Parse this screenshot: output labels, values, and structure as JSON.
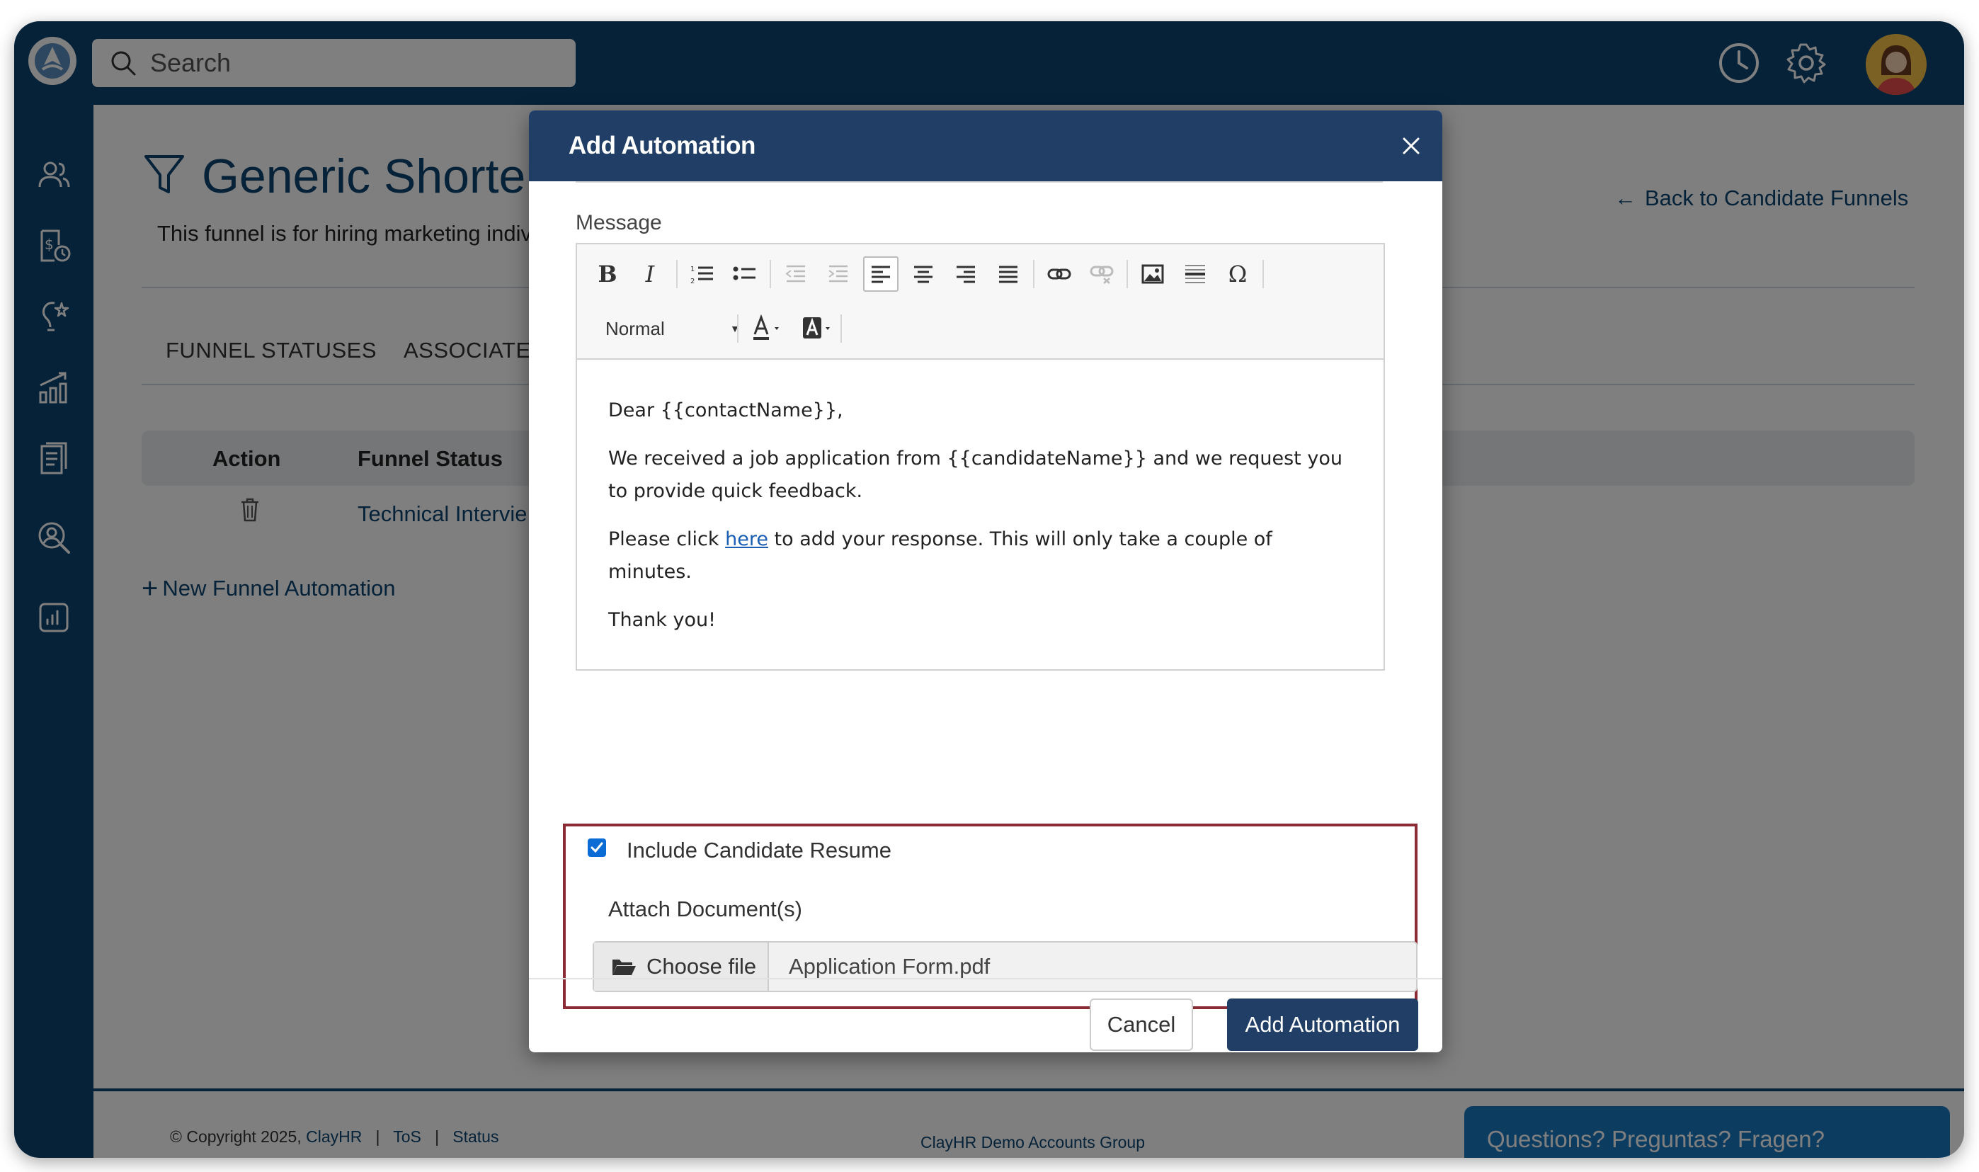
{
  "search": {
    "placeholder": "Search"
  },
  "page": {
    "title": "Generic Shorter",
    "subtitle": "This funnel is for hiring marketing indivi",
    "back_link": "Back to Candidate Funnels",
    "tabs": [
      "FUNNEL STATUSES",
      "ASSOCIATED"
    ],
    "table": {
      "headers": [
        "Action",
        "Funnel Status"
      ],
      "rows": [
        {
          "status": "Technical Intervie"
        }
      ]
    },
    "new_automation": "New Funnel Automation"
  },
  "footer": {
    "copyright": "© Copyright 2025,",
    "brand": "ClayHR",
    "tos": "ToS",
    "status": "Status",
    "separator": "|",
    "group": "ClayHR Demo Accounts Group"
  },
  "help": {
    "label": "Questions? Preguntas? Fragen?"
  },
  "modal": {
    "title": "Add Automation",
    "message_label": "Message",
    "format_select": "Normal",
    "toolbar": {
      "bold": "B",
      "italic": "I",
      "special_char": "Ω"
    },
    "content": {
      "greeting": "Dear {{contactName}},",
      "para1": "We received a job application from {{candidateName}} and we request you to provide quick feedback.",
      "para2_before": "Please click ",
      "para2_link": "here",
      "para2_after": " to add your response. This will only take a couple of minutes.",
      "closing": "Thank you!"
    },
    "include_resume_label": "Include Candidate Resume",
    "include_resume_checked": true,
    "attach_label": "Attach Document(s)",
    "choose_file_label": "Choose file",
    "file_name": "Application Form.pdf",
    "cancel_label": "Cancel",
    "submit_label": "Add Automation"
  },
  "colors": {
    "brand_navy": "#0b4572",
    "modal_header": "#213f66",
    "highlight_border": "#8b2b35",
    "help_blue": "#1a78c2"
  }
}
